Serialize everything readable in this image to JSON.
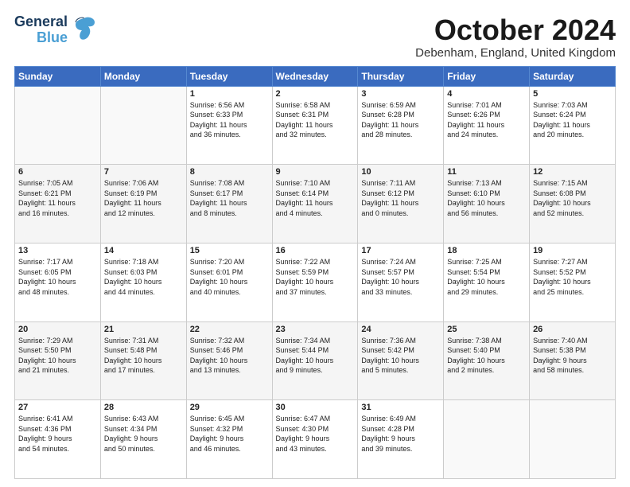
{
  "header": {
    "logo_line1": "General",
    "logo_line2": "Blue",
    "month_title": "October 2024",
    "location": "Debenham, England, United Kingdom"
  },
  "days_of_week": [
    "Sunday",
    "Monday",
    "Tuesday",
    "Wednesday",
    "Thursday",
    "Friday",
    "Saturday"
  ],
  "weeks": [
    [
      {
        "day": "",
        "info": ""
      },
      {
        "day": "",
        "info": ""
      },
      {
        "day": "1",
        "info": "Sunrise: 6:56 AM\nSunset: 6:33 PM\nDaylight: 11 hours\nand 36 minutes."
      },
      {
        "day": "2",
        "info": "Sunrise: 6:58 AM\nSunset: 6:31 PM\nDaylight: 11 hours\nand 32 minutes."
      },
      {
        "day": "3",
        "info": "Sunrise: 6:59 AM\nSunset: 6:28 PM\nDaylight: 11 hours\nand 28 minutes."
      },
      {
        "day": "4",
        "info": "Sunrise: 7:01 AM\nSunset: 6:26 PM\nDaylight: 11 hours\nand 24 minutes."
      },
      {
        "day": "5",
        "info": "Sunrise: 7:03 AM\nSunset: 6:24 PM\nDaylight: 11 hours\nand 20 minutes."
      }
    ],
    [
      {
        "day": "6",
        "info": "Sunrise: 7:05 AM\nSunset: 6:21 PM\nDaylight: 11 hours\nand 16 minutes."
      },
      {
        "day": "7",
        "info": "Sunrise: 7:06 AM\nSunset: 6:19 PM\nDaylight: 11 hours\nand 12 minutes."
      },
      {
        "day": "8",
        "info": "Sunrise: 7:08 AM\nSunset: 6:17 PM\nDaylight: 11 hours\nand 8 minutes."
      },
      {
        "day": "9",
        "info": "Sunrise: 7:10 AM\nSunset: 6:14 PM\nDaylight: 11 hours\nand 4 minutes."
      },
      {
        "day": "10",
        "info": "Sunrise: 7:11 AM\nSunset: 6:12 PM\nDaylight: 11 hours\nand 0 minutes."
      },
      {
        "day": "11",
        "info": "Sunrise: 7:13 AM\nSunset: 6:10 PM\nDaylight: 10 hours\nand 56 minutes."
      },
      {
        "day": "12",
        "info": "Sunrise: 7:15 AM\nSunset: 6:08 PM\nDaylight: 10 hours\nand 52 minutes."
      }
    ],
    [
      {
        "day": "13",
        "info": "Sunrise: 7:17 AM\nSunset: 6:05 PM\nDaylight: 10 hours\nand 48 minutes."
      },
      {
        "day": "14",
        "info": "Sunrise: 7:18 AM\nSunset: 6:03 PM\nDaylight: 10 hours\nand 44 minutes."
      },
      {
        "day": "15",
        "info": "Sunrise: 7:20 AM\nSunset: 6:01 PM\nDaylight: 10 hours\nand 40 minutes."
      },
      {
        "day": "16",
        "info": "Sunrise: 7:22 AM\nSunset: 5:59 PM\nDaylight: 10 hours\nand 37 minutes."
      },
      {
        "day": "17",
        "info": "Sunrise: 7:24 AM\nSunset: 5:57 PM\nDaylight: 10 hours\nand 33 minutes."
      },
      {
        "day": "18",
        "info": "Sunrise: 7:25 AM\nSunset: 5:54 PM\nDaylight: 10 hours\nand 29 minutes."
      },
      {
        "day": "19",
        "info": "Sunrise: 7:27 AM\nSunset: 5:52 PM\nDaylight: 10 hours\nand 25 minutes."
      }
    ],
    [
      {
        "day": "20",
        "info": "Sunrise: 7:29 AM\nSunset: 5:50 PM\nDaylight: 10 hours\nand 21 minutes."
      },
      {
        "day": "21",
        "info": "Sunrise: 7:31 AM\nSunset: 5:48 PM\nDaylight: 10 hours\nand 17 minutes."
      },
      {
        "day": "22",
        "info": "Sunrise: 7:32 AM\nSunset: 5:46 PM\nDaylight: 10 hours\nand 13 minutes."
      },
      {
        "day": "23",
        "info": "Sunrise: 7:34 AM\nSunset: 5:44 PM\nDaylight: 10 hours\nand 9 minutes."
      },
      {
        "day": "24",
        "info": "Sunrise: 7:36 AM\nSunset: 5:42 PM\nDaylight: 10 hours\nand 5 minutes."
      },
      {
        "day": "25",
        "info": "Sunrise: 7:38 AM\nSunset: 5:40 PM\nDaylight: 10 hours\nand 2 minutes."
      },
      {
        "day": "26",
        "info": "Sunrise: 7:40 AM\nSunset: 5:38 PM\nDaylight: 9 hours\nand 58 minutes."
      }
    ],
    [
      {
        "day": "27",
        "info": "Sunrise: 6:41 AM\nSunset: 4:36 PM\nDaylight: 9 hours\nand 54 minutes."
      },
      {
        "day": "28",
        "info": "Sunrise: 6:43 AM\nSunset: 4:34 PM\nDaylight: 9 hours\nand 50 minutes."
      },
      {
        "day": "29",
        "info": "Sunrise: 6:45 AM\nSunset: 4:32 PM\nDaylight: 9 hours\nand 46 minutes."
      },
      {
        "day": "30",
        "info": "Sunrise: 6:47 AM\nSunset: 4:30 PM\nDaylight: 9 hours\nand 43 minutes."
      },
      {
        "day": "31",
        "info": "Sunrise: 6:49 AM\nSunset: 4:28 PM\nDaylight: 9 hours\nand 39 minutes."
      },
      {
        "day": "",
        "info": ""
      },
      {
        "day": "",
        "info": ""
      }
    ]
  ]
}
